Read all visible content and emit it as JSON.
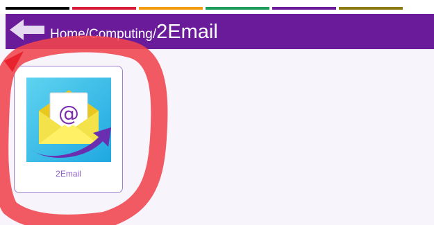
{
  "strip_colors": [
    "#000000",
    "#d81b3a",
    "#f39c12",
    "#1e9c59",
    "#6a1b9a",
    "#8a7a12"
  ],
  "header": {
    "background": "#6a1b9a",
    "back_icon": "arrow-left-icon",
    "breadcrumb": {
      "home": "Home",
      "sep1": "/",
      "computing": "Computing",
      "sep2": "/",
      "current": "2Email"
    }
  },
  "tiles": [
    {
      "label": "2Email",
      "icon": "email-envelope-icon"
    }
  ],
  "annotation": {
    "color": "#f0444c",
    "shape": "hand-drawn-circle-around-tile"
  }
}
